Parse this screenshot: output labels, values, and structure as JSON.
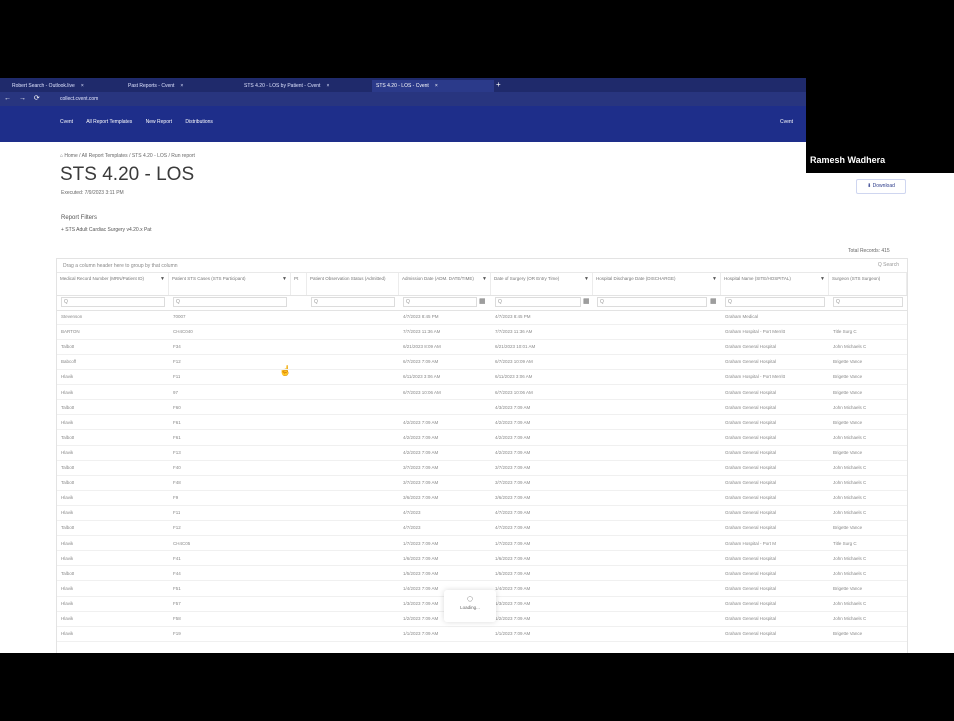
{
  "browser": {
    "tabs": [
      {
        "label": "Robert Search - Outlook.live",
        "active": false
      },
      {
        "label": "Past Reports - Cvent",
        "active": false
      },
      {
        "label": "STS 4.20 - LOS by Patient - Cvent",
        "active": false
      },
      {
        "label": "STS 4.20 - LOS - Cvent",
        "active": true
      }
    ],
    "new_tab": "+",
    "url": "collect.cvent.com",
    "nav_buttons": "← → ⟳"
  },
  "app": {
    "menu": [
      "Cvent",
      "All Report Templates",
      "New Report",
      "Distributions"
    ],
    "user": "Cvent"
  },
  "webcam": {
    "name": "Ramesh Wadhera"
  },
  "page": {
    "breadcrumb": "⌂ Home / All Report Templates / STS 4.20 - LOS / Run report",
    "title": "STS 4.20 - LOS",
    "subtitle": "Executed: 7/9/2023 3:11 PM",
    "download": "⬇ Download",
    "filters_label": "Report Filters",
    "filter_chip": "+ STS Adult Cardiac Surgery v4.20.x Pat",
    "total": "Total Records: 415"
  },
  "grid": {
    "grouping_hint": "Drag a column header here to group by that column",
    "search": "Q Search",
    "columns": [
      "Medical Record Number (MRN/Patient ID)",
      "Patient STS Cases (STS Participant)",
      "Pt",
      "Patient Observation Status (Admitted)",
      "Admission Date (ADM. DATE/TIME)",
      "Date of Surgery (OR Entry Time)",
      "Hospital Discharge Date (DISCHARGE)",
      "Hospital Name (SITE/HOSPITAL)",
      "Surgeon (STS Surgeon)"
    ],
    "rows": [
      [
        "Stevenson",
        "70007",
        "",
        "4/7/2023 8:45 PM",
        "4/7/2023 8:45 PM",
        "",
        "Graham Medical",
        ""
      ],
      [
        "BARTON",
        "CH4C040",
        "",
        "7/7/2023 11:36 AM",
        "7/7/2023 11:36 AM",
        "",
        "Graham Hospital - Port Merritt",
        "Title Surg C"
      ],
      [
        "Talbott",
        "F34",
        "",
        "6/21/2023 8:09 AM",
        "6/21/2023 10:01 AM",
        "",
        "Graham General Hospital",
        "John Michaels C"
      ],
      [
        "Babcoff",
        "F12",
        "",
        "6/7/2023 7:09 AM",
        "6/7/2023 10:09 AM",
        "",
        "Graham General Hospital",
        "Brigette Vance"
      ],
      [
        "Hlavik",
        "F11",
        "",
        "6/11/2023 3:06 AM",
        "6/11/2023 3:06 AM",
        "",
        "Graham Hospital - Port Merritt",
        "Brigette Vance"
      ],
      [
        "Hlavik",
        "97",
        "",
        "6/7/2023 10:06 AM",
        "6/7/2023 10:06 AM",
        "",
        "Graham General Hospital",
        "Brigette Vance"
      ],
      [
        "Talbott",
        "F60",
        "",
        "",
        "4/3/2023 7:09 AM",
        "",
        "Graham General Hospital",
        "John Michaels C"
      ],
      [
        "Hlavik",
        "F61",
        "",
        "4/2/2023 7:09 AM",
        "4/2/2023 7:09 AM",
        "",
        "Graham General Hospital",
        "Brigette Vance"
      ],
      [
        "Talbott",
        "F61",
        "",
        "4/2/2023 7:09 AM",
        "4/2/2023 7:09 AM",
        "",
        "Graham General Hospital",
        "John Michaels C"
      ],
      [
        "Hlavik",
        "F13",
        "",
        "4/2/2023 7:09 AM",
        "4/2/2023 7:09 AM",
        "",
        "Graham General Hospital",
        "Brigette Vance"
      ],
      [
        "Talbott",
        "F40",
        "",
        "3/7/2023 7:09 AM",
        "3/7/2023 7:09 AM",
        "",
        "Graham General Hospital",
        "John Michaels C"
      ],
      [
        "Talbott",
        "F48",
        "",
        "3/7/2023 7:09 AM",
        "3/7/2023 7:09 AM",
        "",
        "Graham General Hospital",
        "John Michaels C"
      ],
      [
        "Hlavik",
        "F9",
        "",
        "3/6/2023 7:09 AM",
        "3/6/2023 7:09 AM",
        "",
        "Graham General Hospital",
        "John Michaels C"
      ],
      [
        "Hlavik",
        "F11",
        "",
        "4/7/2023",
        "4/7/2023 7:09 AM",
        "",
        "Graham General Hospital",
        "John Michaels C"
      ],
      [
        "Talbott",
        "F12",
        "",
        "4/7/2023",
        "4/7/2023 7:09 AM",
        "",
        "Graham General Hospital",
        "Brigette Vance"
      ],
      [
        "Hlavik",
        "CH4C05",
        "",
        "1/7/2023 7:09 AM",
        "1/7/2023 7:09 AM",
        "",
        "Graham Hospital - Port M",
        "Title Surg C"
      ],
      [
        "Hlavik",
        "F41",
        "",
        "1/6/2023 7:09 AM",
        "1/6/2023 7:09 AM",
        "",
        "Graham General Hospital",
        "John Michaels C"
      ],
      [
        "Talbott",
        "F44",
        "",
        "1/5/2023 7:09 AM",
        "1/5/2023 7:09 AM",
        "",
        "Graham General Hospital",
        "John Michaels C"
      ],
      [
        "Hlavik",
        "F51",
        "",
        "1/4/2023 7:09 AM",
        "1/4/2023 7:09 AM",
        "",
        "Graham General Hospital",
        "Brigette Vance"
      ],
      [
        "Hlavik",
        "F57",
        "",
        "1/3/2023 7:09 AM",
        "1/3/2023 7:09 AM",
        "",
        "Graham General Hospital",
        "John Michaels C"
      ],
      [
        "Hlavik",
        "F58",
        "",
        "1/2/2023 7:09 AM",
        "1/2/2023 7:09 AM",
        "",
        "Graham General Hospital",
        "John Michaels C"
      ],
      [
        "Hlavik",
        "F19",
        "",
        "1/1/2023 7:09 AM",
        "1/1/2023 7:09 AM",
        "",
        "Graham General Hospital",
        "Brigette Vance"
      ]
    ]
  },
  "loading": {
    "label": "Loading..."
  }
}
